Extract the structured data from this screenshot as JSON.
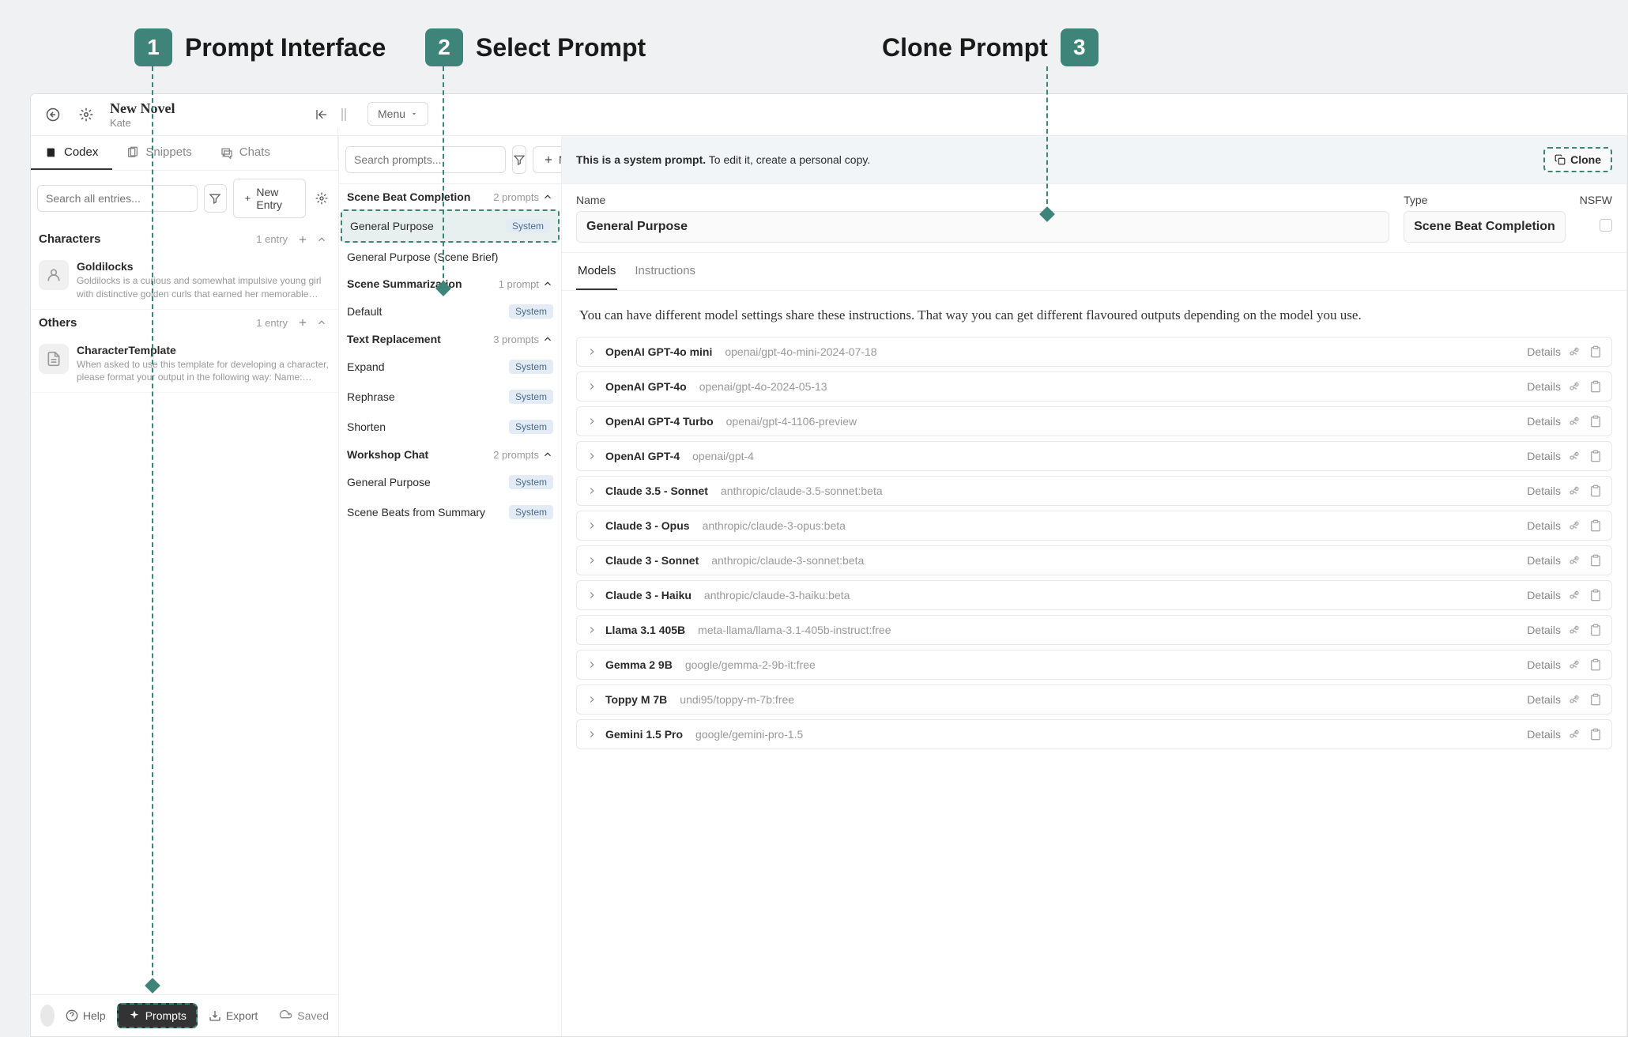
{
  "annotations": {
    "a1": "Prompt Interface",
    "a2": "Select Prompt",
    "a3": "Clone Prompt"
  },
  "titlebar": {
    "title": "New Novel",
    "author": "Kate",
    "menu": "Menu"
  },
  "left": {
    "tabs": {
      "codex": "Codex",
      "snippets": "Snippets",
      "chats": "Chats"
    },
    "search_placeholder": "Search all entries...",
    "new_entry": "New Entry",
    "sections": [
      {
        "title": "Characters",
        "count": "1 entry"
      },
      {
        "title": "Others",
        "count": "1 entry"
      }
    ],
    "entries": [
      {
        "title": "Goldilocks",
        "desc": "Goldilocks is a curious and somewhat impulsive young girl with distinctive golden curls that earned her memorable name...."
      },
      {
        "title": "CharacterTemplate",
        "desc": "When asked to use this template for developing a character, please format your output in the following way: Name: Age:..."
      }
    ]
  },
  "mid": {
    "search_placeholder": "Search prompts...",
    "new": "New",
    "groups": [
      {
        "title": "Scene Beat Completion",
        "count": "2 prompts",
        "items": [
          {
            "label": "General Purpose",
            "system": true,
            "selected": true
          },
          {
            "label": "General Purpose (Scene Brief)",
            "system": false
          }
        ]
      },
      {
        "title": "Scene Summarization",
        "count": "1 prompt",
        "items": [
          {
            "label": "Default",
            "system": true
          }
        ]
      },
      {
        "title": "Text Replacement",
        "count": "3 prompts",
        "items": [
          {
            "label": "Expand",
            "system": true
          },
          {
            "label": "Rephrase",
            "system": true
          },
          {
            "label": "Shorten",
            "system": true
          }
        ]
      },
      {
        "title": "Workshop Chat",
        "count": "2 prompts",
        "items": [
          {
            "label": "General Purpose",
            "system": true
          },
          {
            "label": "Scene Beats from Summary",
            "system": true
          }
        ]
      }
    ]
  },
  "right": {
    "banner_strong": "This is a system prompt.",
    "banner_rest": " To edit it, create a personal copy.",
    "clone": "Clone",
    "labels": {
      "name": "Name",
      "type": "Type",
      "nsfw": "NSFW"
    },
    "values": {
      "name": "General Purpose",
      "type": "Scene Beat Completion"
    },
    "subtabs": {
      "models": "Models",
      "instructions": "Instructions"
    },
    "models_desc": "You can have different model settings share these instructions. That way you can get different flavoured outputs depending on the model you use.",
    "details": "Details",
    "models": [
      {
        "name": "OpenAI GPT-4o mini",
        "id": "openai/gpt-4o-mini-2024-07-18"
      },
      {
        "name": "OpenAI GPT-4o",
        "id": "openai/gpt-4o-2024-05-13"
      },
      {
        "name": "OpenAI GPT-4 Turbo",
        "id": "openai/gpt-4-1106-preview"
      },
      {
        "name": "OpenAI GPT-4",
        "id": "openai/gpt-4"
      },
      {
        "name": "Claude 3.5 - Sonnet",
        "id": "anthropic/claude-3.5-sonnet:beta"
      },
      {
        "name": "Claude 3 - Opus",
        "id": "anthropic/claude-3-opus:beta"
      },
      {
        "name": "Claude 3 - Sonnet",
        "id": "anthropic/claude-3-sonnet:beta"
      },
      {
        "name": "Claude 3 - Haiku",
        "id": "anthropic/claude-3-haiku:beta"
      },
      {
        "name": "Llama 3.1 405B",
        "id": "meta-llama/llama-3.1-405b-instruct:free"
      },
      {
        "name": "Gemma 2 9B",
        "id": "google/gemma-2-9b-it:free"
      },
      {
        "name": "Toppy M 7B",
        "id": "undi95/toppy-m-7b:free"
      },
      {
        "name": "Gemini 1.5 Pro",
        "id": "google/gemini-pro-1.5"
      }
    ],
    "badge_system": "System"
  },
  "footer": {
    "help": "Help",
    "prompts": "Prompts",
    "export": "Export",
    "saved": "Saved"
  }
}
